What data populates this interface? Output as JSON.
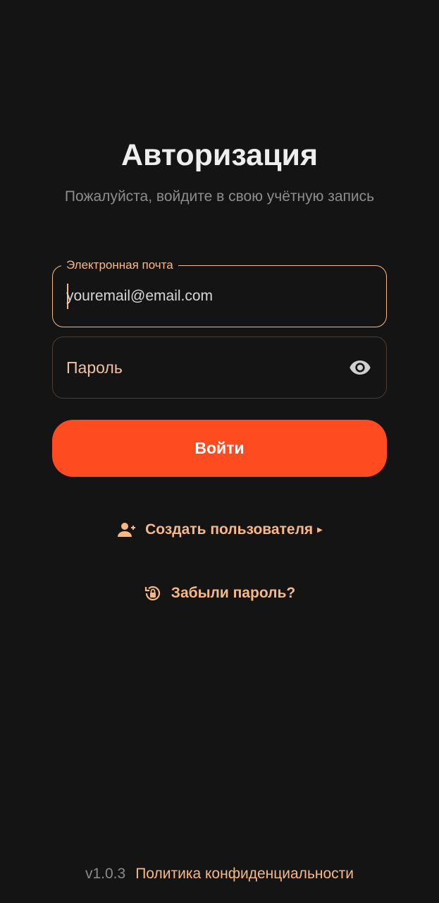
{
  "header": {
    "title": "Авторизация",
    "subtitle": "Пожалуйста, войдите в свою учётную запись"
  },
  "form": {
    "email": {
      "label": "Электронная почта",
      "placeholder": "youremail@email.com",
      "value": ""
    },
    "password": {
      "placeholder": "Пароль",
      "value": "",
      "toggle_icon": "eye-icon"
    },
    "submit_label": "Войти"
  },
  "links": {
    "create_user": {
      "label": "Создать пользователя",
      "icon": "person-add-icon",
      "suffix_icon": "triangle-right-icon"
    },
    "forgot_password": {
      "label": "Забыли пароль?",
      "icon": "lock-reset-icon"
    }
  },
  "footer": {
    "version": "v1.0.3",
    "privacy_label": "Политика конфиденциальности"
  },
  "colors": {
    "background": "#141414",
    "accent": "#f7b886",
    "button": "#ff4b20",
    "muted": "#8d8d8d"
  }
}
